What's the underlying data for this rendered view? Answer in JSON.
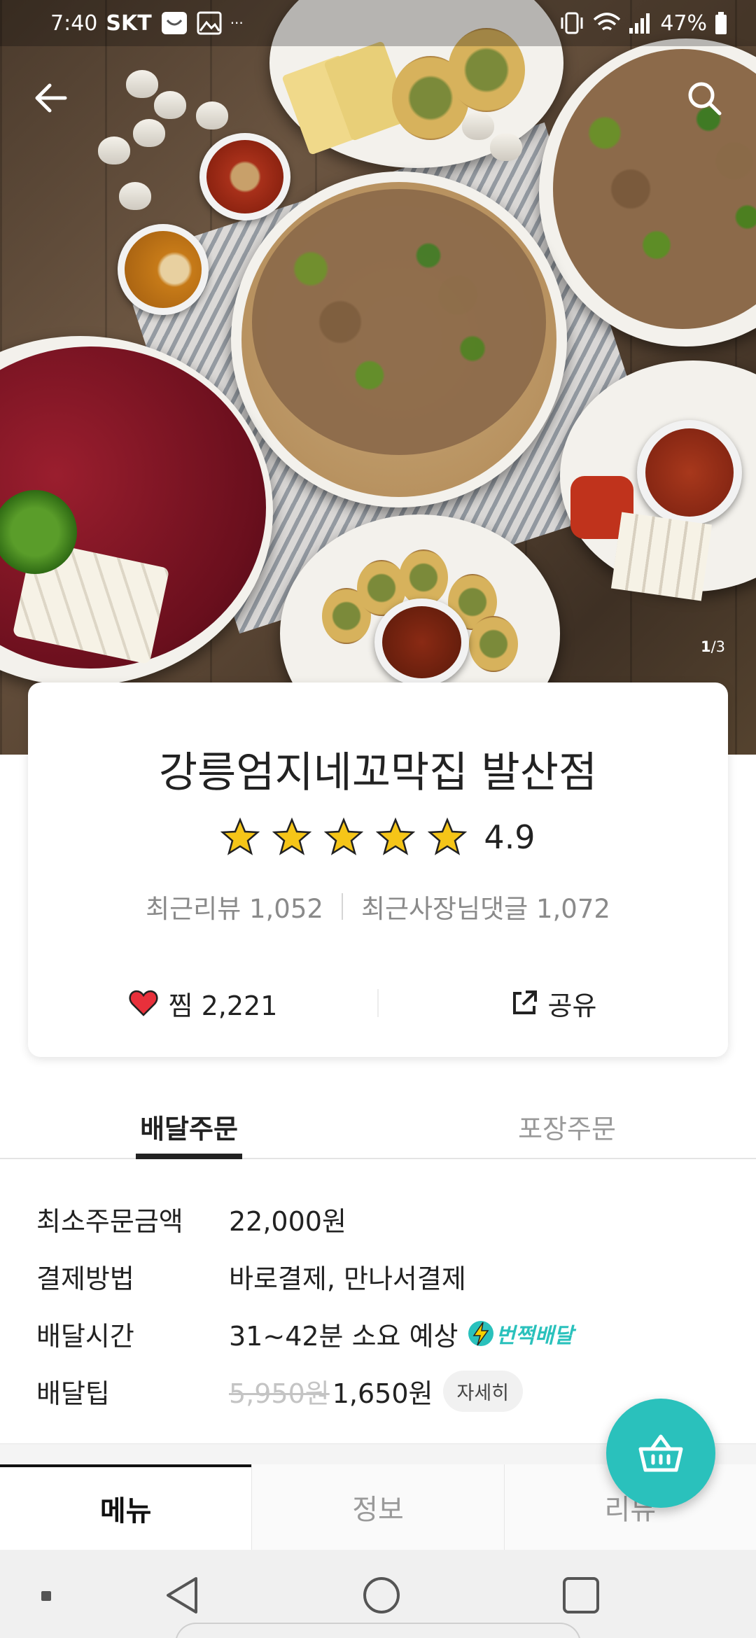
{
  "status_bar": {
    "time": "7:40",
    "carrier": "SKT",
    "extra": "···",
    "battery": "47%"
  },
  "hero": {
    "counter_current": "1",
    "counter_total": "/3"
  },
  "shop": {
    "name": "강릉엄지네꼬막집 발산점",
    "rating": "4.9",
    "stars": 5,
    "recent_reviews": "최근리뷰 1,052",
    "owner_replies": "최근사장님댓글 1,072",
    "like_label": "찜",
    "like_count": "2,221",
    "share_label": "공유"
  },
  "order_tabs": {
    "delivery": "배달주문",
    "pickup": "포장주문"
  },
  "details": {
    "min_order_label": "최소주문금액",
    "min_order_value": "22,000원",
    "payment_label": "결제방법",
    "payment_value": "바로결제, 만나서결제",
    "time_label": "배달시간",
    "time_value": "31~42분 소요 예상",
    "flash_label": "번쩍배달",
    "tip_label": "배달팁",
    "tip_original": "5,950원",
    "tip_value": "1,650원",
    "tip_detail_button": "자세히"
  },
  "bottom_tabs": {
    "menu": "메뉴",
    "info": "정보",
    "review": "리뷰"
  },
  "colors": {
    "accent": "#2ac1bc",
    "heart": "#e8303b",
    "star": "#f5c518"
  }
}
